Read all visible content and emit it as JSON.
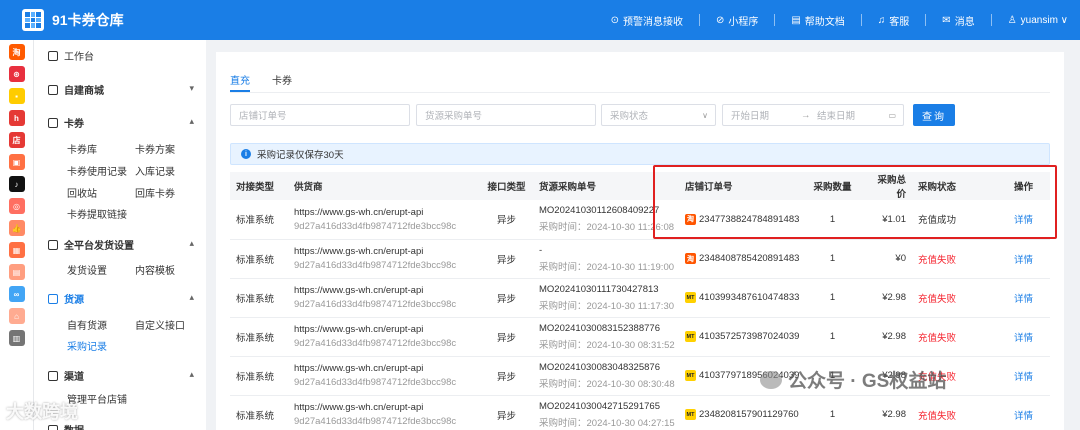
{
  "app": {
    "title": "91卡券仓库"
  },
  "topnav": [
    {
      "icon": "bell-icon",
      "glyph": "⊙",
      "label": "预警消息接收"
    },
    {
      "icon": "mini-program-icon",
      "glyph": "⊘",
      "label": "小程序"
    },
    {
      "icon": "document-icon",
      "glyph": "▤",
      "label": "帮助文档"
    },
    {
      "icon": "headset-icon",
      "glyph": "♫",
      "label": "客服"
    },
    {
      "icon": "mail-icon",
      "glyph": "✉",
      "label": "消息"
    },
    {
      "icon": "user-icon",
      "glyph": "♙",
      "label": "yuansim ∨"
    }
  ],
  "rail": [
    {
      "name": "taobao-app-icon",
      "color": "#ff5a00",
      "text": "淘"
    },
    {
      "name": "app-2-icon",
      "color": "#e8303f",
      "text": "⊛"
    },
    {
      "name": "app-3-icon",
      "color": "#ffcc00",
      "text": "▪"
    },
    {
      "name": "app-4-icon",
      "color": "#e53935",
      "text": "h"
    },
    {
      "name": "dian-app-icon",
      "color": "#e53935",
      "text": "店"
    },
    {
      "name": "app-6-icon",
      "color": "#ff7043",
      "text": "▣"
    },
    {
      "name": "tiktok-app-icon",
      "color": "#111111",
      "text": "♪"
    },
    {
      "name": "app-8-icon",
      "color": "#ff6f61",
      "text": "◎"
    },
    {
      "name": "app-9-icon",
      "color": "#ff8a65",
      "text": "👍"
    },
    {
      "name": "app-10-icon",
      "color": "#ff7043",
      "text": "▦"
    },
    {
      "name": "app-11-icon",
      "color": "#ff9e80",
      "text": "▤"
    },
    {
      "name": "app-12-icon",
      "color": "#42a5f5",
      "text": "∞"
    },
    {
      "name": "app-13-icon",
      "color": "#ffab91",
      "text": "⌂"
    },
    {
      "name": "app-14-icon",
      "color": "#757575",
      "text": "▥"
    }
  ],
  "sidebar": {
    "workbench": "工作台",
    "mall": "自建商城",
    "card": "卡券",
    "card_items": [
      "卡券库",
      "卡券方案",
      "卡券使用记录",
      "入库记录",
      "回收站",
      "回库卡券",
      "卡券提取链接"
    ],
    "shipping": "全平台发货设置",
    "shipping_items": [
      "发货设置",
      "内容模板"
    ],
    "source": "货源",
    "source_items": [
      "自有货源",
      "自定义接口",
      "采购记录"
    ],
    "channel": "渠道",
    "channel_items": [
      "管理平台店铺"
    ],
    "data": "数据"
  },
  "tabs": [
    "直充",
    "卡券"
  ],
  "filters": {
    "shop_order": "店铺订单号",
    "source_order": "货源采购单号",
    "status": "采购状态",
    "start_date": "开始日期",
    "arrow": "→",
    "end_date": "结束日期",
    "query": "查询"
  },
  "alert": "采购记录仅保存30天",
  "table": {
    "headers": [
      "对接类型",
      "供货商",
      "接口类型",
      "货源采购单号",
      "店铺订单号",
      "采购数量",
      "采购总价",
      "采购状态",
      "操作"
    ],
    "rows": [
      {
        "type": "标准系统",
        "supplier": "https://www.gs-wh.cn/erupt-api",
        "supplier_id": "9d27a416d33d4fb9874712fde3bcc98c",
        "iface": "异步",
        "po": "MO20241030112608409227",
        "po_time": "采购时间：2024-10-30 11:26:08",
        "platform": "tb",
        "shop_order": "2347738824784891483",
        "qty": "1",
        "total": "¥1.01",
        "status": "充值成功",
        "status_color": "#333333",
        "action": "详情"
      },
      {
        "type": "标准系统",
        "supplier": "https://www.gs-wh.cn/erupt-api",
        "supplier_id": "9d27a416d33d4fb9874712fde3bcc98c",
        "iface": "异步",
        "po": "-",
        "po_time": "采购时间：2024-10-30 11:19:00",
        "platform": "tb",
        "shop_order": "2348408785420891483",
        "qty": "1",
        "total": "¥0",
        "status": "充值失败",
        "status_color": "#f5222d",
        "action": "详情"
      },
      {
        "type": "标准系统",
        "supplier": "https://www.gs-wh.cn/erupt-api",
        "supplier_id": "9d27a416d33d4fb9874712fde3bcc98c",
        "iface": "异步",
        "po": "MO20241030111730427813",
        "po_time": "采购时间：2024-10-30 11:17:30",
        "platform": "mt",
        "shop_order": "4103993487610474833",
        "qty": "1",
        "total": "¥2.98",
        "status": "充值失败",
        "status_color": "#f5222d",
        "action": "详情"
      },
      {
        "type": "标准系统",
        "supplier": "https://www.gs-wh.cn/erupt-api",
        "supplier_id": "9d27a416d33d4fb9874712fde3bcc98c",
        "iface": "异步",
        "po": "MO20241030083152388776",
        "po_time": "采购时间：2024-10-30 08:31:52",
        "platform": "mt",
        "shop_order": "4103572573987024039",
        "qty": "1",
        "total": "¥2.98",
        "status": "充值失败",
        "status_color": "#f5222d",
        "action": "详情"
      },
      {
        "type": "标准系统",
        "supplier": "https://www.gs-wh.cn/erupt-api",
        "supplier_id": "9d27a416d33d4fb9874712fde3bcc98c",
        "iface": "异步",
        "po": "MO20241030083048325876",
        "po_time": "采购时间：2024-10-30 08:30:48",
        "platform": "mt",
        "shop_order": "4103779718956024039",
        "qty": "1",
        "total": "¥2.98",
        "status": "充值失败",
        "status_color": "#f5222d",
        "action": "详情"
      },
      {
        "type": "标准系统",
        "supplier": "https://www.gs-wh.cn/erupt-api",
        "supplier_id": "9d27a416d33d4fb9874712fde3bcc98c",
        "iface": "异步",
        "po": "MO20241030042715291765",
        "po_time": "采购时间：2024-10-30 04:27:15",
        "platform": "mt",
        "shop_order": "2348208157901129760",
        "qty": "1",
        "total": "¥2.98",
        "status": "充值失败",
        "status_color": "#f5222d",
        "action": "详情"
      }
    ]
  },
  "watermarks": {
    "left": "大数跨境",
    "right": "公众号 · GS权益站"
  }
}
